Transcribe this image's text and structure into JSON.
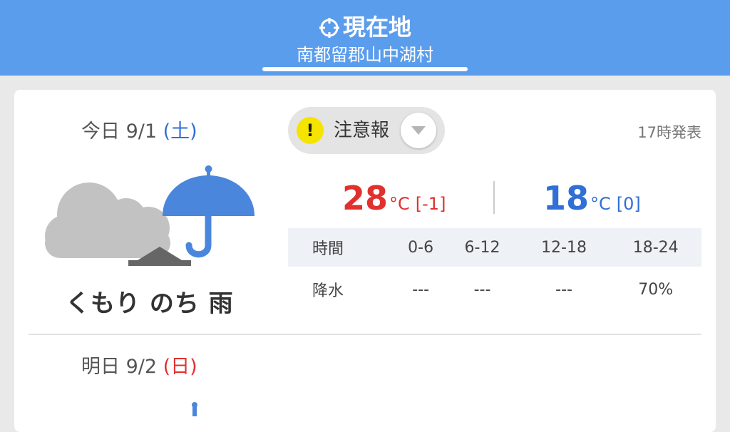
{
  "header": {
    "title": "現在地",
    "location": "南都留郡山中湖村"
  },
  "today": {
    "date_label": "今日 9/1",
    "weekday": "(土)",
    "warning_label": "注意報",
    "warning_mark": "!",
    "announce_time": "17時発表",
    "weather_text": "くもり のち 雨",
    "high": {
      "value": "28",
      "unit": "°C",
      "diff": "[-1]"
    },
    "low": {
      "value": "18",
      "unit": "°C",
      "diff": "[0]"
    },
    "rain": {
      "header_label": "時間",
      "row_label": "降水",
      "periods": [
        "0-6",
        "6-12",
        "12-18",
        "18-24"
      ],
      "values": [
        "---",
        "---",
        "---",
        "70%"
      ]
    }
  },
  "tomorrow": {
    "date_label": "明日 9/2",
    "weekday": "(日)"
  },
  "colors": {
    "header_bg": "#5b9ded",
    "high_temp": "#e0312f",
    "low_temp": "#2f6fd6",
    "saturday": "#2f6fd6",
    "sunday": "#e0312f",
    "warning": "#f5e300"
  },
  "icons": {
    "location": "target-icon",
    "weather_today": "cloudy-then-rain-icon",
    "warning": "exclamation-icon",
    "dropdown": "triangle-down-icon"
  }
}
